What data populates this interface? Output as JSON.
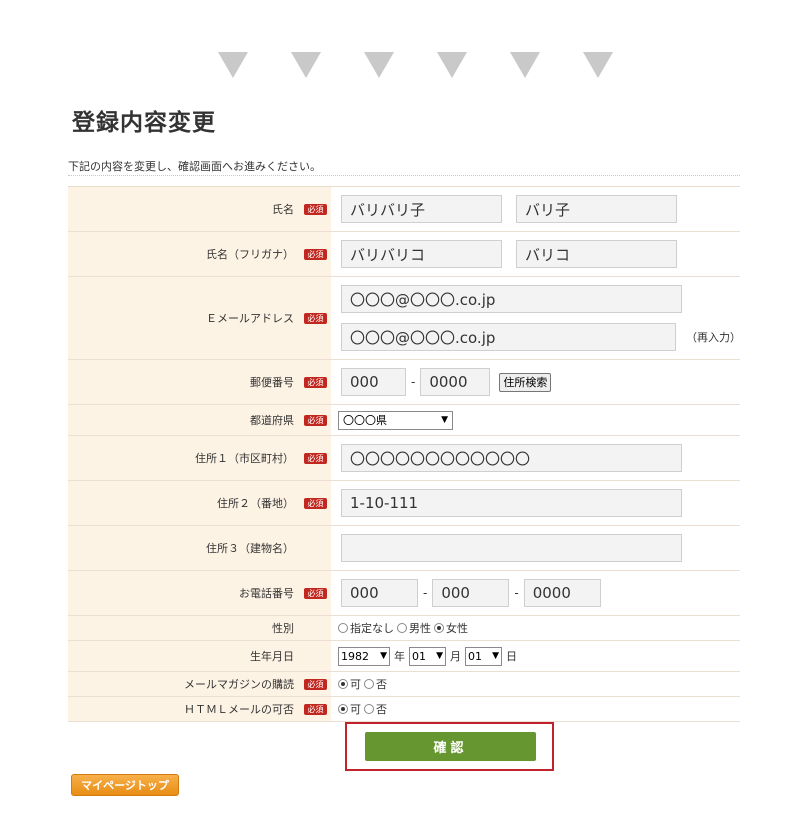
{
  "page": {
    "title": "登録内容変更",
    "intro": "下記の内容を変更し、確認画面へお進みください。"
  },
  "required_label": "必須",
  "fields": {
    "name": {
      "label": "氏名",
      "last": "バリバリ子",
      "first": "バリ子"
    },
    "kana": {
      "label": "氏名（フリガナ）",
      "last": "バリバリコ",
      "first": "バリコ"
    },
    "email": {
      "label": "Ｅメールアドレス",
      "value": "〇〇〇@〇〇〇.co.jp",
      "confirm": "〇〇〇@〇〇〇.co.jp",
      "reinput_note": "（再入力）"
    },
    "zip": {
      "label": "郵便番号",
      "part1": "000",
      "part2": "0000",
      "search_button": "住所検索"
    },
    "prefecture": {
      "label": "都道府県",
      "selected": "〇〇〇県"
    },
    "address1": {
      "label": "住所１（市区町村）",
      "value": "〇〇〇〇〇〇〇〇〇〇〇〇"
    },
    "address2": {
      "label": "住所２（番地）",
      "value": "1-10-111"
    },
    "address3": {
      "label": "住所３（建物名）",
      "value": ""
    },
    "phone": {
      "label": "お電話番号",
      "part1": "000",
      "part2": "000",
      "part3": "0000"
    },
    "gender": {
      "label": "性別",
      "options": [
        "指定なし",
        "男性",
        "女性"
      ],
      "selected": "女性"
    },
    "birthday": {
      "label": "生年月日",
      "year": "1982",
      "month": "01",
      "day": "01",
      "year_unit": "年",
      "month_unit": "月",
      "day_unit": "日"
    },
    "magazine": {
      "label": "メールマガジンの購読",
      "options": [
        "可",
        "否"
      ],
      "selected": "可"
    },
    "html_mail": {
      "label": "ＨＴＭＬメールの可否",
      "options": [
        "可",
        "否"
      ],
      "selected": "可"
    }
  },
  "buttons": {
    "confirm": "確認",
    "mypage_top": "マイページトップ"
  },
  "colors": {
    "label_bg": "#fdf3e5",
    "required_badge": "#c2271f",
    "confirm_button": "#66962f",
    "confirm_highlight": "#c0232d",
    "mypage_button": "#f0a030"
  }
}
